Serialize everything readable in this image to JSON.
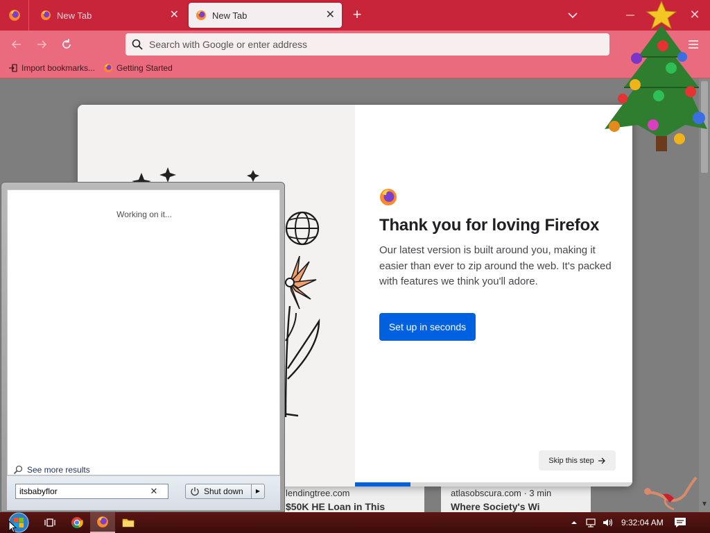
{
  "browser": {
    "tabs": [
      {
        "label": "New Tab",
        "active": false
      },
      {
        "label": "New Tab",
        "active": true
      }
    ],
    "urlbar_placeholder": "Search with Google or enter address",
    "bookmarks": [
      {
        "label": "Import bookmarks...",
        "icon": "import-icon"
      },
      {
        "label": "Getting Started",
        "icon": "firefox-icon"
      }
    ],
    "theme_colors": {
      "tabbar": "#c8243a",
      "toolbar": "#ea6b7e",
      "active_tab": "#f4eef0"
    }
  },
  "welcome": {
    "title": "Thank you for loving Firefox",
    "body": "Our latest version is built around you, making it easier than ever to zip around the web. It's packed with features we think you'll adore.",
    "primary_button": "Set up in seconds",
    "skip_button": "Skip this step",
    "progress_fraction": 0.2,
    "accent_color": "#0061e0"
  },
  "background_cards": [
    {
      "source": "lendingtree.com",
      "headline": "$50K HE Loan in This"
    },
    {
      "source": "atlasobscura.com · 3 min",
      "headline": "Where Society's Wi"
    }
  ],
  "start_menu": {
    "status": "Working on it...",
    "see_more": "See more results",
    "search_value": "itsbabyflor",
    "clear_glyph": "✕",
    "shutdown_label": "Shut down",
    "shutdown_arrow": "▶"
  },
  "taskbar": {
    "apps": [
      "task-view-icon",
      "chrome-icon",
      "firefox-icon",
      "file-explorer-icon"
    ],
    "clock": "9:32:04 AM"
  }
}
